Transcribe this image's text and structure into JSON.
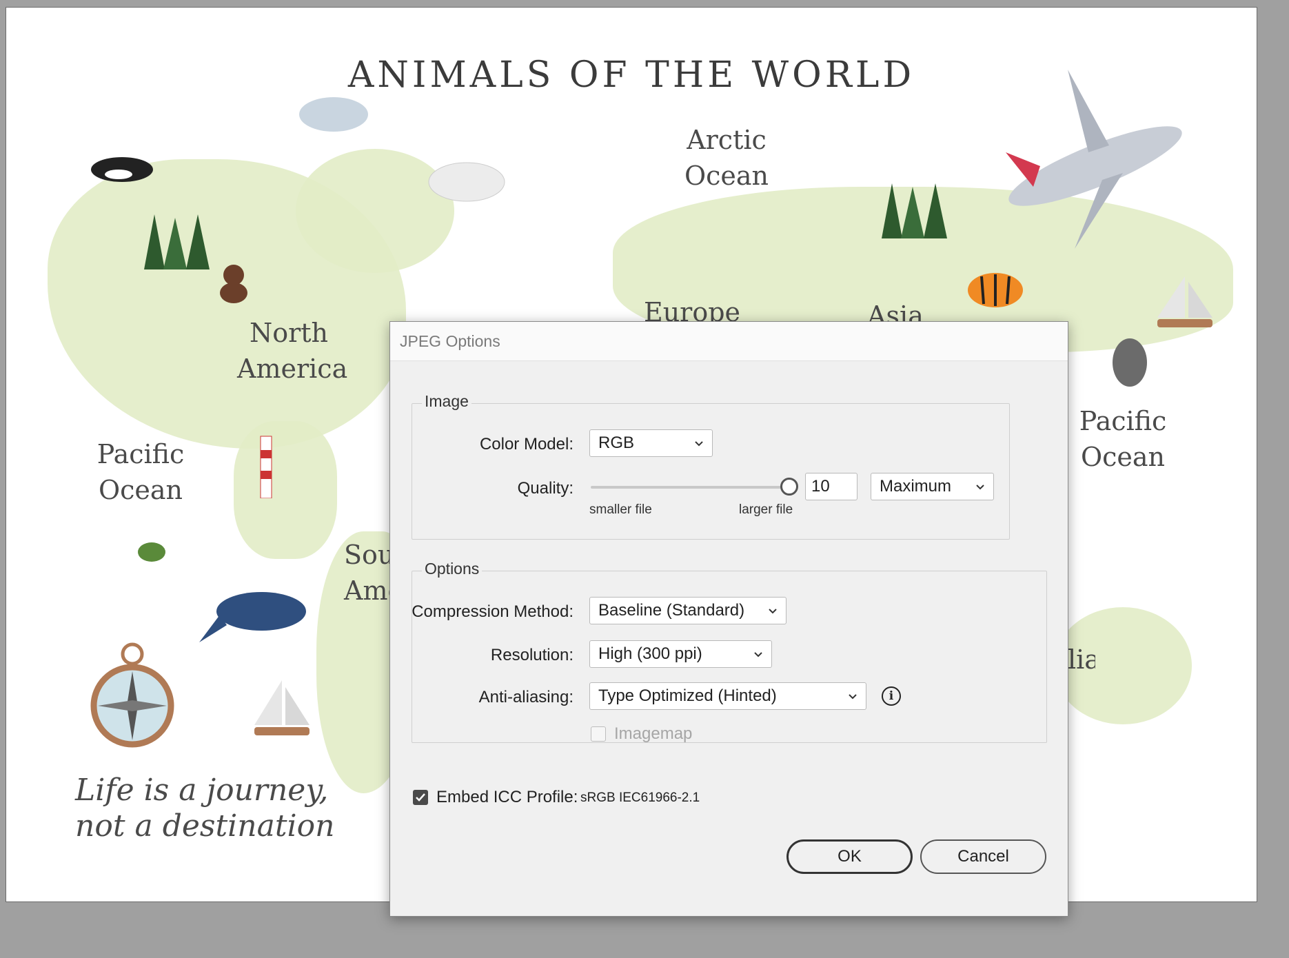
{
  "artboard": {
    "title": "ANIMALS OF THE WORLD",
    "labels": {
      "arctic_ocean": [
        "Arctic",
        "Ocean"
      ],
      "north_america": [
        "North",
        "America"
      ],
      "europe": "Europe",
      "asia": "Asia",
      "pacific_ocean_left": [
        "Pacific",
        "Ocean"
      ],
      "pacific_ocean_right": [
        "Pacific",
        "Ocean"
      ],
      "south_america_partial": [
        "Sou",
        "Ame"
      ],
      "australia_partial": "lia"
    },
    "quote": [
      "Life is a journey,",
      "not a destination"
    ]
  },
  "dialog": {
    "title": "JPEG Options",
    "image_group": {
      "label": "Image",
      "color_model_label": "Color Model:",
      "color_model_value": "RGB",
      "quality_label": "Quality:",
      "quality_value": "10",
      "quality_fraction": 1.0,
      "smaller_file_label": "smaller file",
      "larger_file_label": "larger file",
      "quality_preset": "Maximum"
    },
    "options_group": {
      "label": "Options",
      "compression_label": "Compression Method:",
      "compression_value": "Baseline (Standard)",
      "resolution_label": "Resolution:",
      "resolution_value": "High (300 ppi)",
      "antialiasing_label": "Anti-aliasing:",
      "antialiasing_value": "Type Optimized (Hinted)",
      "imagemap_label": "Imagemap",
      "imagemap_checked": false,
      "imagemap_enabled": false
    },
    "embed_icc_label": "Embed ICC Profile:",
    "embed_icc_profile": "sRGB IEC61966-2.1",
    "embed_icc_checked": true,
    "ok_label": "OK",
    "cancel_label": "Cancel"
  },
  "colors": {
    "land": "#e2ecc6",
    "canvas_background": "#a0a0a0",
    "dialog_background": "#f0f0f0"
  }
}
